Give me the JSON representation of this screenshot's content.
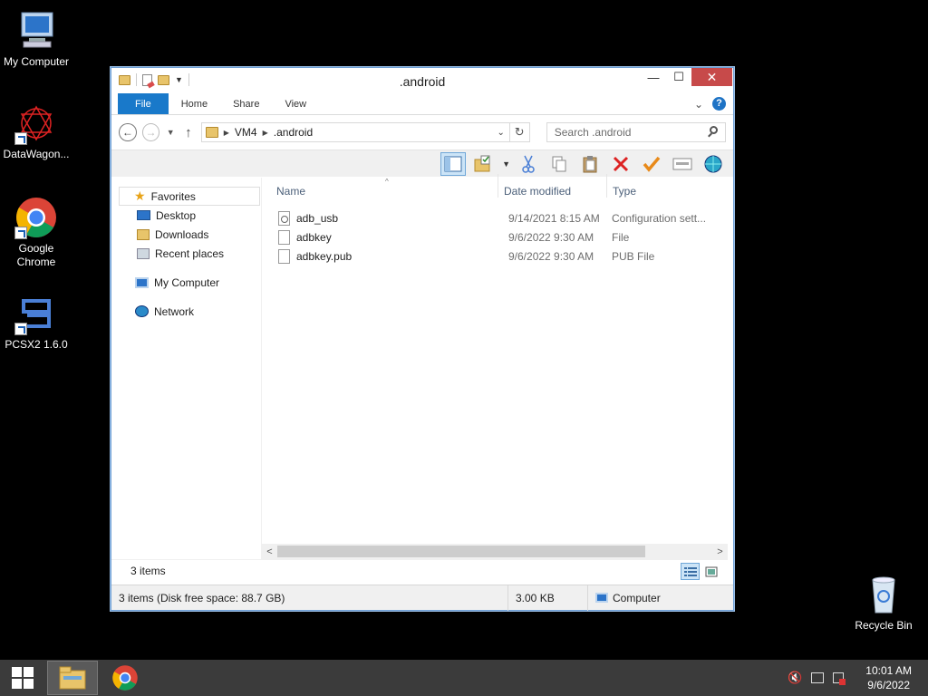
{
  "desktop": {
    "icons": [
      {
        "label": "My Computer"
      },
      {
        "label": "DataWagon..."
      },
      {
        "label": "Google Chrome"
      },
      {
        "label": "PCSX2 1.6.0"
      },
      {
        "label": "Recycle Bin"
      }
    ]
  },
  "window": {
    "title": ".android",
    "close_glyph": "✕",
    "maximize_glyph": "☐",
    "minimize_glyph": "—"
  },
  "ribbon": {
    "tabs": [
      "File",
      "Home",
      "Share",
      "View"
    ],
    "help_glyph": "?",
    "collapse_glyph": "⌄"
  },
  "address": {
    "breadcrumb": [
      "VM4",
      ".android"
    ],
    "search_placeholder": "Search .android"
  },
  "navpane": {
    "favorites": "Favorites",
    "favorites_items": [
      "Desktop",
      "Downloads",
      "Recent places"
    ],
    "computer": "My Computer",
    "network": "Network"
  },
  "columns": {
    "name": "Name",
    "date": "Date modified",
    "type": "Type"
  },
  "files": [
    {
      "name": "adb_usb",
      "date": "9/14/2021 8:15 AM",
      "type": "Configuration sett...",
      "icon": "config-file-icon"
    },
    {
      "name": "adbkey",
      "date": "9/6/2022 9:30 AM",
      "type": "File",
      "icon": "file-icon"
    },
    {
      "name": "adbkey.pub",
      "date": "9/6/2022 9:30 AM",
      "type": "PUB File",
      "icon": "file-icon"
    }
  ],
  "status": {
    "item_count": "3 items",
    "details": "3 items (Disk free space: 88.7 GB)",
    "size": "3.00 KB",
    "location": "Computer"
  },
  "taskbar": {
    "time": "10:01 AM",
    "date": "9/6/2022"
  },
  "colors": {
    "file_tab": "#1979ca",
    "close_button": "#c74a4a",
    "taskbar": "#3b3b3b",
    "accent_selection": "#cce4f7"
  }
}
